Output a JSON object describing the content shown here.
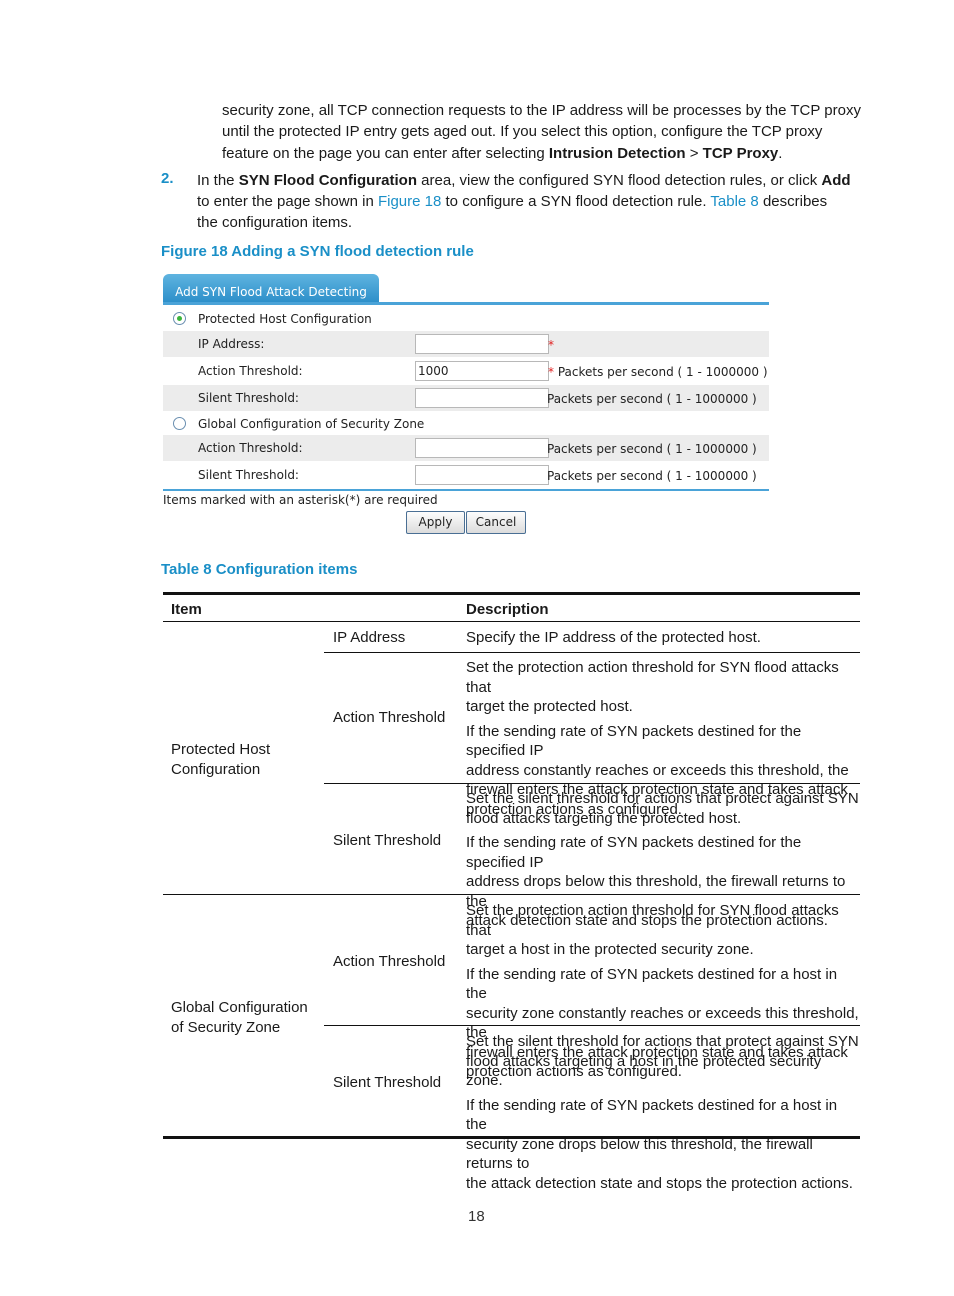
{
  "intro": {
    "line1": "security zone, all TCP connection requests to the IP address will be processes by the TCP proxy",
    "line2": "until the protected IP entry gets aged out. If you select this option, configure the TCP proxy",
    "line3_prefix": "feature on the page you can enter after selecting ",
    "line3_bold1": "Intrusion Detection",
    "line3_sep": " > ",
    "line3_bold2": "TCP Proxy",
    "line3_suffix": "."
  },
  "step2": {
    "number": "2.",
    "t1": "In the ",
    "b1": "SYN Flood Configuration",
    "t2": " area, view the configured SYN flood detection rules, or click ",
    "b2": "Add",
    "t3": "to enter the page shown in ",
    "link1": "Figure 18",
    "t4": " to configure a SYN flood detection rule. ",
    "link2": "Table 8",
    "t5": " describes",
    "t6": "the configuration items."
  },
  "figure": {
    "caption": "Figure 18 Adding a SYN flood detection rule",
    "tab_label": "Add SYN Flood Attack Detecting",
    "protected_host_label": "Protected Host Configuration",
    "protected_host_selected": true,
    "ip_label": "IP Address:",
    "ip_value": "",
    "ip_required": "*",
    "action_label": "Action Threshold:",
    "action_value": "1000",
    "action_required": "*",
    "action_hint": " Packets per second ( 1 - 1000000 )",
    "silent_label": "Silent Threshold:",
    "silent_value": "",
    "silent_hint": "Packets per second ( 1 - 1000000 )",
    "global_label": "Global Configuration of Security Zone",
    "global_selected": false,
    "g_action_label": "Action Threshold:",
    "g_action_value": "",
    "g_action_hint": "Packets per second ( 1 - 1000000 )",
    "g_silent_label": "Silent Threshold:",
    "g_silent_value": "",
    "g_silent_hint": "Packets per second ( 1 - 1000000 )",
    "required_note": "Items marked with an asterisk(*) are required",
    "apply_label": "Apply",
    "cancel_label": "Cancel"
  },
  "table": {
    "caption": "Table 8 Configuration items",
    "headers": {
      "item": "Item",
      "description": "Description"
    },
    "groups": [
      {
        "name_line1": "Protected Host",
        "name_line2": "Configuration",
        "rows": [
          {
            "item": "IP Address",
            "desc": [
              "Specify the IP address of the protected host."
            ]
          },
          {
            "item": "Action Threshold",
            "desc": [
              "Set the protection action threshold for SYN flood attacks that",
              "target the protected host.",
              "If the sending rate of SYN packets destined for the specified IP",
              "address constantly reaches or exceeds this threshold, the",
              "firewall enters the attack protection state and takes attack",
              "protection actions as configured."
            ]
          },
          {
            "item": "Silent Threshold",
            "desc": [
              "Set the silent threshold for actions that protect against SYN",
              "flood attacks targeting the protected host.",
              "If the sending rate of SYN packets destined for the specified IP",
              "address drops below this threshold, the firewall returns to the",
              "attack detection state and stops the protection actions."
            ]
          }
        ]
      },
      {
        "name_line1": "Global Configuration",
        "name_line2": "of Security Zone",
        "rows": [
          {
            "item": "Action Threshold",
            "desc": [
              "Set the protection action threshold for SYN flood attacks that",
              "target a host in the protected security zone.",
              "If the sending rate of SYN packets destined for a host in the",
              "security zone constantly reaches or exceeds this threshold, the",
              "firewall enters the attack protection state and takes attack",
              "protection actions as configured."
            ]
          },
          {
            "item": "Silent Threshold",
            "desc": [
              "Set the silent threshold for actions that protect against SYN",
              "flood attacks targeting a host in the protected security zone.",
              "If the sending rate of SYN packets destined for a host in the",
              "security zone drops below this threshold, the firewall returns to",
              "the attack detection state and stops the protection actions."
            ]
          }
        ]
      }
    ]
  },
  "page_number": "18"
}
